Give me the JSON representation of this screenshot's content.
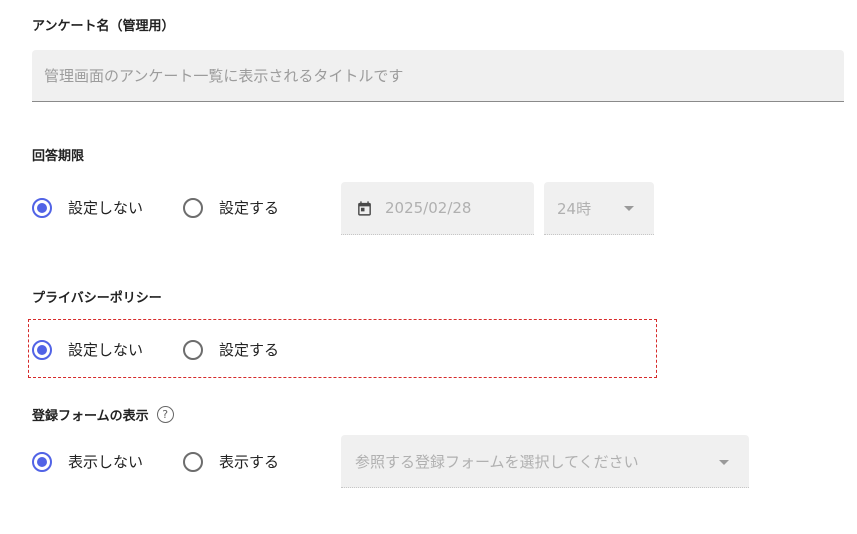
{
  "survey_name": {
    "label": "アンケート名（管理用）",
    "placeholder": "管理画面のアンケート一覧に表示されるタイトルです",
    "value": ""
  },
  "deadline": {
    "label": "回答期限",
    "options": [
      {
        "label": "設定しない",
        "selected": true
      },
      {
        "label": "設定する",
        "selected": false
      }
    ],
    "date_value": "2025/02/28",
    "hour_value": "24時"
  },
  "privacy_policy": {
    "label": "プライバシーポリシー",
    "options": [
      {
        "label": "設定しない",
        "selected": true
      },
      {
        "label": "設定する",
        "selected": false
      }
    ]
  },
  "registration_form": {
    "label": "登録フォームの表示",
    "help_icon": "help-icon",
    "options": [
      {
        "label": "表示しない",
        "selected": true
      },
      {
        "label": "表示する",
        "selected": false
      }
    ],
    "select_placeholder": "参照する登録フォームを選択してください"
  },
  "colors": {
    "accent": "#5163e6",
    "highlight_border": "#d62a2a",
    "field_bg": "#f0f0f0"
  }
}
